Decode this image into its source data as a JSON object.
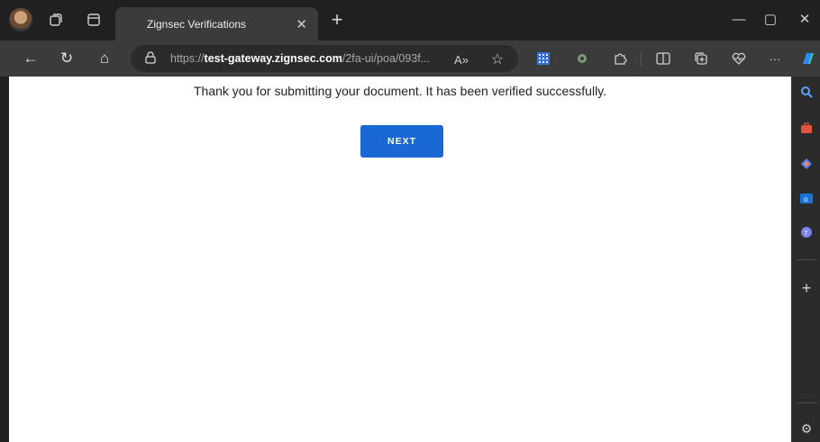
{
  "colors": {
    "accent": "#1a67d6",
    "chrome_dark": "#202020",
    "chrome_toolbar": "#3b3b3b",
    "page_bg": "#ffffff"
  },
  "titlebar": {
    "icons": [
      "profile-avatar",
      "workspaces-icon",
      "tab-actions-icon"
    ],
    "tab": {
      "title": "Zignsec Verifications",
      "close_glyph": "✕"
    },
    "new_tab_glyph": "+",
    "window_controls": {
      "minimize": "—",
      "maximize": "▢",
      "close": "✕"
    }
  },
  "toolbar": {
    "back_glyph": "←",
    "refresh_glyph": "↻",
    "home_glyph": "⌂",
    "address": {
      "lock_glyph": "🔒︎",
      "url_scheme": "https://",
      "url_host": "test-gateway.zignsec.com",
      "url_path": "/2fa-ui/poa/093f...",
      "read_aloud_glyph": "A»",
      "favorite_glyph": "☆"
    },
    "extensions": [
      "grid-extension-icon",
      "gear-extension-icon",
      "puzzle-extensions-icon",
      "split-screen-icon",
      "collections-icon",
      "heart-pulse-icon",
      "more-icon",
      "copilot-icon"
    ],
    "more_glyph": "···"
  },
  "page": {
    "message": "Thank you for submitting your document. It has been verified successfully.",
    "next_label": "NEXT"
  },
  "sidebar": {
    "icons": [
      "search-icon",
      "briefcase-icon",
      "copilot-sidebar-icon",
      "outlook-icon",
      "teams-icon",
      "add-icon",
      "settings-icon"
    ],
    "add_glyph": "+",
    "settings_glyph": "⚙"
  }
}
